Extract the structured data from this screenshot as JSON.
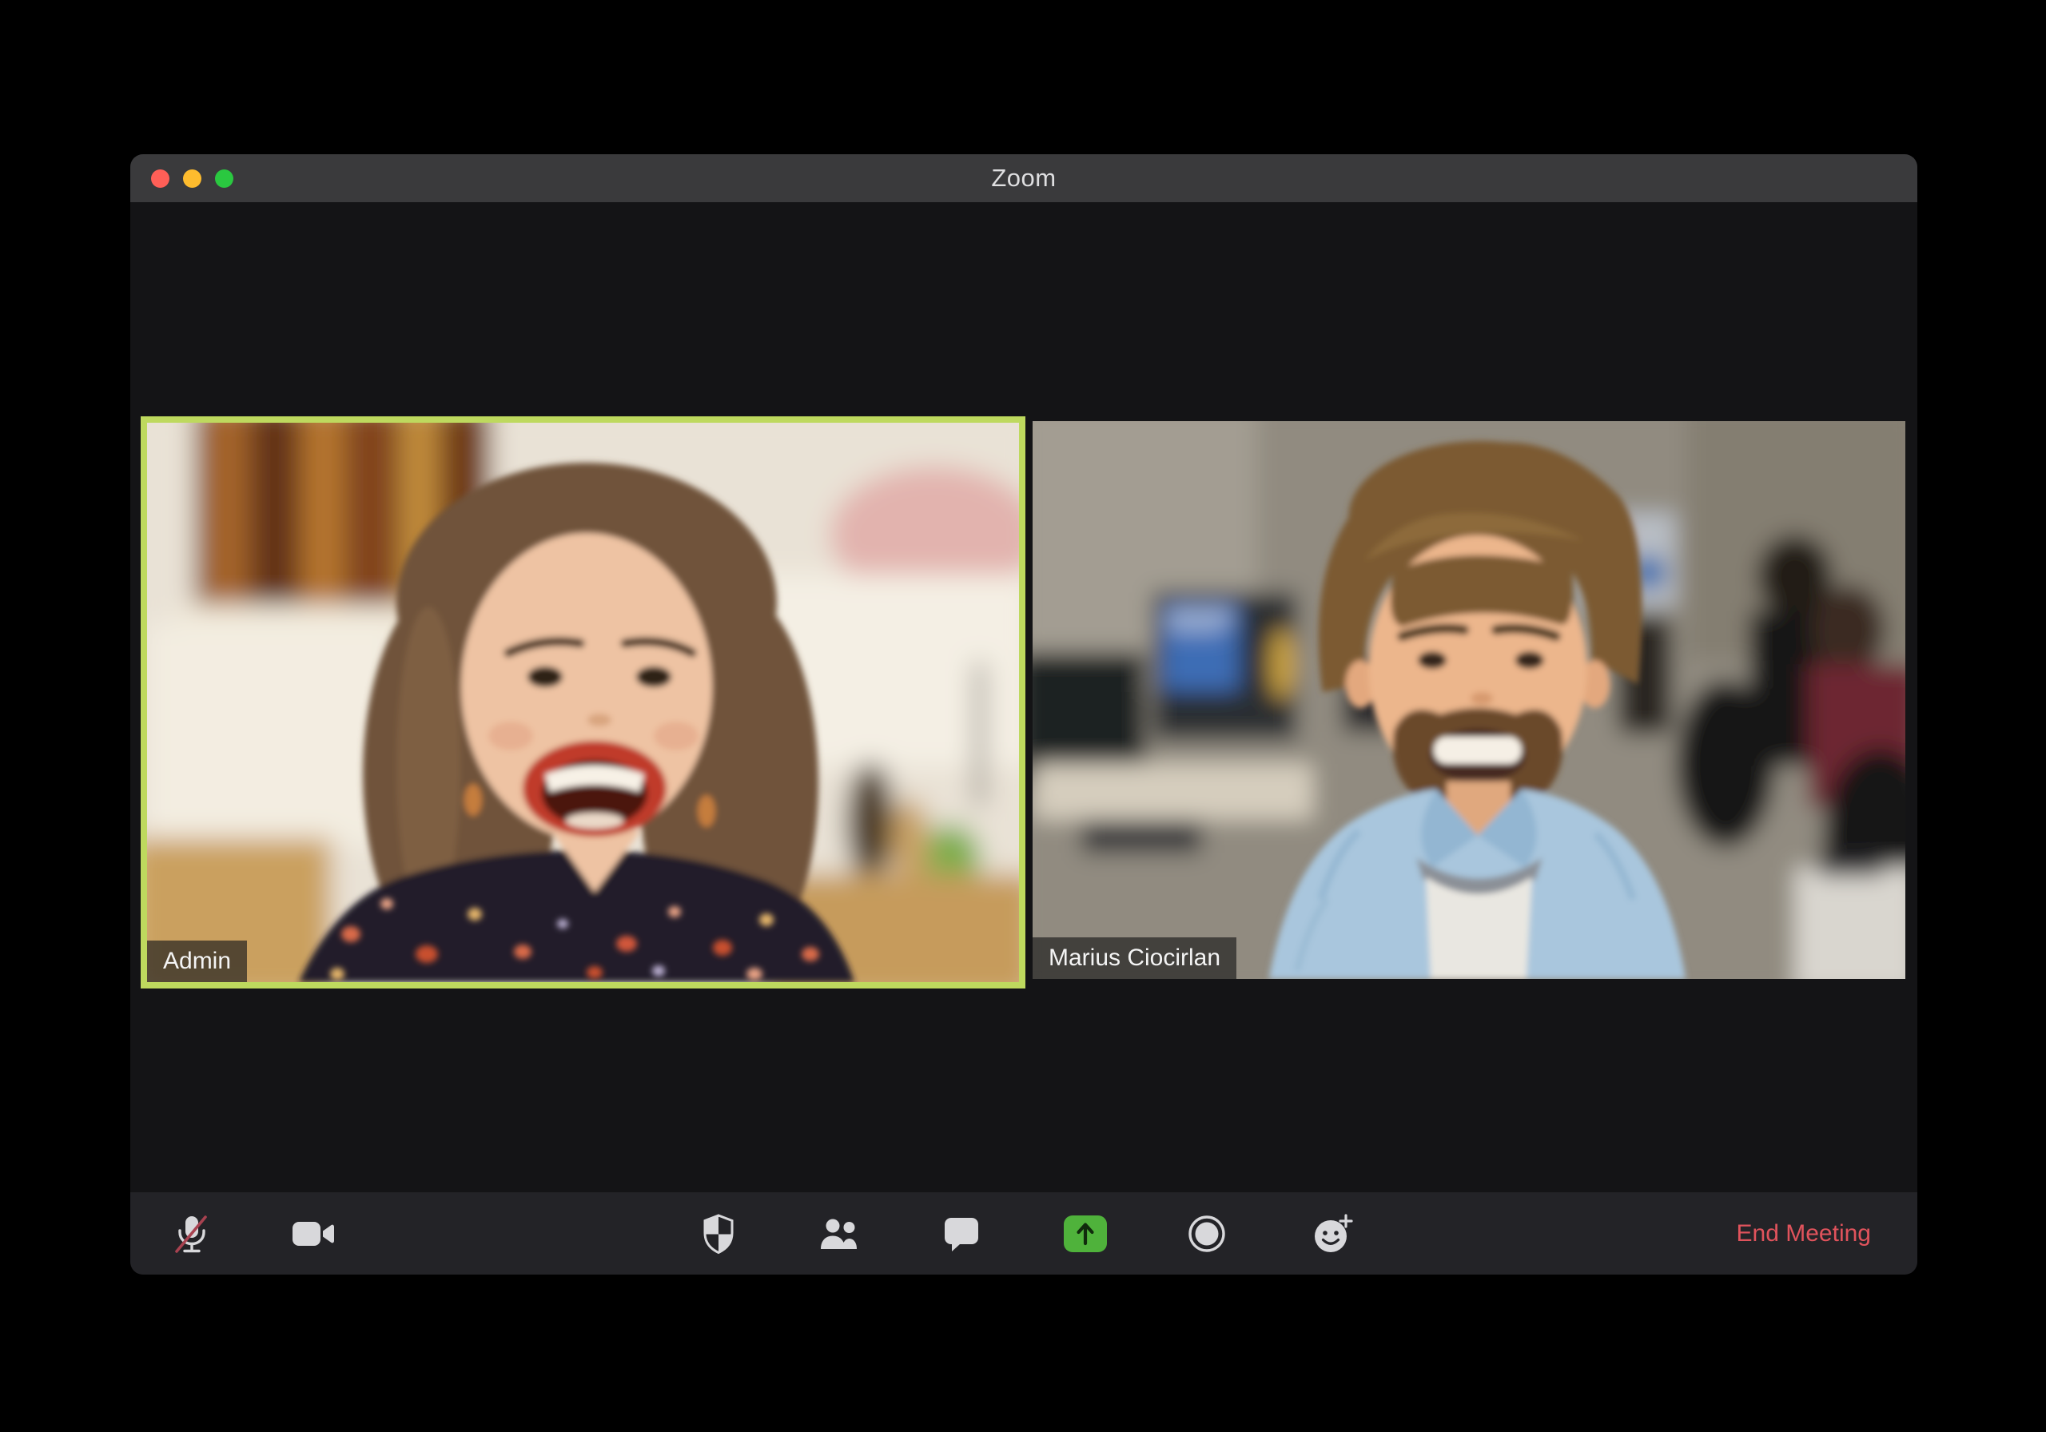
{
  "window": {
    "title": "Zoom",
    "titlebar_buttons": [
      "close",
      "minimize",
      "fullscreen"
    ]
  },
  "participants": [
    {
      "name": "Admin",
      "active_speaker": true,
      "muted_overlay": false
    },
    {
      "name": "Marius Ciocirlan",
      "active_speaker": false,
      "muted_overlay": false
    }
  ],
  "toolbar": {
    "buttons": [
      {
        "id": "mute",
        "icon": "microphone-muted-icon",
        "state": "muted"
      },
      {
        "id": "video",
        "icon": "video-camera-icon",
        "state": "on"
      },
      {
        "id": "security",
        "icon": "shield-icon"
      },
      {
        "id": "participants",
        "icon": "participants-icon"
      },
      {
        "id": "chat",
        "icon": "chat-bubble-icon"
      },
      {
        "id": "share-screen",
        "icon": "share-screen-up-arrow-icon",
        "accent": "#4fb23b"
      },
      {
        "id": "record",
        "icon": "record-circle-icon"
      },
      {
        "id": "reactions",
        "icon": "smiley-plus-icon"
      }
    ],
    "end_meeting_label": "End Meeting"
  },
  "colors": {
    "page_background": "#000000",
    "window_background": "#141416",
    "titlebar_background": "#3a3a3c",
    "toolbar_background": "#232327",
    "active_speaker_border": "#bed95e",
    "end_meeting_red": "#e0535c",
    "share_accent_green": "#4fb23b",
    "traffic_red": "#ff5f57",
    "traffic_yellow": "#febc2e",
    "traffic_green": "#2ac840",
    "icon_gray": "#d8d8db",
    "mute_slash_red": "#a84250"
  }
}
